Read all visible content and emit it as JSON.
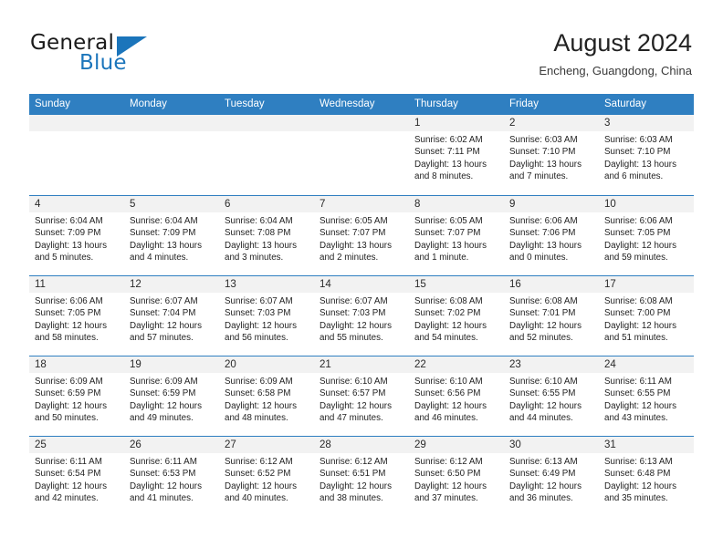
{
  "logo": {
    "word1": "General",
    "word2": "Blue",
    "triangle_color": "#1b75bb"
  },
  "header": {
    "title": "August 2024",
    "subtitle": "Encheng, Guangdong, China"
  },
  "theme": {
    "header_blue": "#2f7fc1",
    "date_band_gray": "#f2f2f2",
    "body_white": "#ffffff"
  },
  "weekdays": [
    "Sunday",
    "Monday",
    "Tuesday",
    "Wednesday",
    "Thursday",
    "Friday",
    "Saturday"
  ],
  "weeks": [
    [
      {
        "day": "",
        "sunrise": "",
        "sunset": "",
        "daylight_line1": "",
        "daylight_line2": ""
      },
      {
        "day": "",
        "sunrise": "",
        "sunset": "",
        "daylight_line1": "",
        "daylight_line2": ""
      },
      {
        "day": "",
        "sunrise": "",
        "sunset": "",
        "daylight_line1": "",
        "daylight_line2": ""
      },
      {
        "day": "",
        "sunrise": "",
        "sunset": "",
        "daylight_line1": "",
        "daylight_line2": ""
      },
      {
        "day": "1",
        "sunrise": "Sunrise: 6:02 AM",
        "sunset": "Sunset: 7:11 PM",
        "daylight_line1": "Daylight: 13 hours",
        "daylight_line2": "and 8 minutes."
      },
      {
        "day": "2",
        "sunrise": "Sunrise: 6:03 AM",
        "sunset": "Sunset: 7:10 PM",
        "daylight_line1": "Daylight: 13 hours",
        "daylight_line2": "and 7 minutes."
      },
      {
        "day": "3",
        "sunrise": "Sunrise: 6:03 AM",
        "sunset": "Sunset: 7:10 PM",
        "daylight_line1": "Daylight: 13 hours",
        "daylight_line2": "and 6 minutes."
      }
    ],
    [
      {
        "day": "4",
        "sunrise": "Sunrise: 6:04 AM",
        "sunset": "Sunset: 7:09 PM",
        "daylight_line1": "Daylight: 13 hours",
        "daylight_line2": "and 5 minutes."
      },
      {
        "day": "5",
        "sunrise": "Sunrise: 6:04 AM",
        "sunset": "Sunset: 7:09 PM",
        "daylight_line1": "Daylight: 13 hours",
        "daylight_line2": "and 4 minutes."
      },
      {
        "day": "6",
        "sunrise": "Sunrise: 6:04 AM",
        "sunset": "Sunset: 7:08 PM",
        "daylight_line1": "Daylight: 13 hours",
        "daylight_line2": "and 3 minutes."
      },
      {
        "day": "7",
        "sunrise": "Sunrise: 6:05 AM",
        "sunset": "Sunset: 7:07 PM",
        "daylight_line1": "Daylight: 13 hours",
        "daylight_line2": "and 2 minutes."
      },
      {
        "day": "8",
        "sunrise": "Sunrise: 6:05 AM",
        "sunset": "Sunset: 7:07 PM",
        "daylight_line1": "Daylight: 13 hours",
        "daylight_line2": "and 1 minute."
      },
      {
        "day": "9",
        "sunrise": "Sunrise: 6:06 AM",
        "sunset": "Sunset: 7:06 PM",
        "daylight_line1": "Daylight: 13 hours",
        "daylight_line2": "and 0 minutes."
      },
      {
        "day": "10",
        "sunrise": "Sunrise: 6:06 AM",
        "sunset": "Sunset: 7:05 PM",
        "daylight_line1": "Daylight: 12 hours",
        "daylight_line2": "and 59 minutes."
      }
    ],
    [
      {
        "day": "11",
        "sunrise": "Sunrise: 6:06 AM",
        "sunset": "Sunset: 7:05 PM",
        "daylight_line1": "Daylight: 12 hours",
        "daylight_line2": "and 58 minutes."
      },
      {
        "day": "12",
        "sunrise": "Sunrise: 6:07 AM",
        "sunset": "Sunset: 7:04 PM",
        "daylight_line1": "Daylight: 12 hours",
        "daylight_line2": "and 57 minutes."
      },
      {
        "day": "13",
        "sunrise": "Sunrise: 6:07 AM",
        "sunset": "Sunset: 7:03 PM",
        "daylight_line1": "Daylight: 12 hours",
        "daylight_line2": "and 56 minutes."
      },
      {
        "day": "14",
        "sunrise": "Sunrise: 6:07 AM",
        "sunset": "Sunset: 7:03 PM",
        "daylight_line1": "Daylight: 12 hours",
        "daylight_line2": "and 55 minutes."
      },
      {
        "day": "15",
        "sunrise": "Sunrise: 6:08 AM",
        "sunset": "Sunset: 7:02 PM",
        "daylight_line1": "Daylight: 12 hours",
        "daylight_line2": "and 54 minutes."
      },
      {
        "day": "16",
        "sunrise": "Sunrise: 6:08 AM",
        "sunset": "Sunset: 7:01 PM",
        "daylight_line1": "Daylight: 12 hours",
        "daylight_line2": "and 52 minutes."
      },
      {
        "day": "17",
        "sunrise": "Sunrise: 6:08 AM",
        "sunset": "Sunset: 7:00 PM",
        "daylight_line1": "Daylight: 12 hours",
        "daylight_line2": "and 51 minutes."
      }
    ],
    [
      {
        "day": "18",
        "sunrise": "Sunrise: 6:09 AM",
        "sunset": "Sunset: 6:59 PM",
        "daylight_line1": "Daylight: 12 hours",
        "daylight_line2": "and 50 minutes."
      },
      {
        "day": "19",
        "sunrise": "Sunrise: 6:09 AM",
        "sunset": "Sunset: 6:59 PM",
        "daylight_line1": "Daylight: 12 hours",
        "daylight_line2": "and 49 minutes."
      },
      {
        "day": "20",
        "sunrise": "Sunrise: 6:09 AM",
        "sunset": "Sunset: 6:58 PM",
        "daylight_line1": "Daylight: 12 hours",
        "daylight_line2": "and 48 minutes."
      },
      {
        "day": "21",
        "sunrise": "Sunrise: 6:10 AM",
        "sunset": "Sunset: 6:57 PM",
        "daylight_line1": "Daylight: 12 hours",
        "daylight_line2": "and 47 minutes."
      },
      {
        "day": "22",
        "sunrise": "Sunrise: 6:10 AM",
        "sunset": "Sunset: 6:56 PM",
        "daylight_line1": "Daylight: 12 hours",
        "daylight_line2": "and 46 minutes."
      },
      {
        "day": "23",
        "sunrise": "Sunrise: 6:10 AM",
        "sunset": "Sunset: 6:55 PM",
        "daylight_line1": "Daylight: 12 hours",
        "daylight_line2": "and 44 minutes."
      },
      {
        "day": "24",
        "sunrise": "Sunrise: 6:11 AM",
        "sunset": "Sunset: 6:55 PM",
        "daylight_line1": "Daylight: 12 hours",
        "daylight_line2": "and 43 minutes."
      }
    ],
    [
      {
        "day": "25",
        "sunrise": "Sunrise: 6:11 AM",
        "sunset": "Sunset: 6:54 PM",
        "daylight_line1": "Daylight: 12 hours",
        "daylight_line2": "and 42 minutes."
      },
      {
        "day": "26",
        "sunrise": "Sunrise: 6:11 AM",
        "sunset": "Sunset: 6:53 PM",
        "daylight_line1": "Daylight: 12 hours",
        "daylight_line2": "and 41 minutes."
      },
      {
        "day": "27",
        "sunrise": "Sunrise: 6:12 AM",
        "sunset": "Sunset: 6:52 PM",
        "daylight_line1": "Daylight: 12 hours",
        "daylight_line2": "and 40 minutes."
      },
      {
        "day": "28",
        "sunrise": "Sunrise: 6:12 AM",
        "sunset": "Sunset: 6:51 PM",
        "daylight_line1": "Daylight: 12 hours",
        "daylight_line2": "and 38 minutes."
      },
      {
        "day": "29",
        "sunrise": "Sunrise: 6:12 AM",
        "sunset": "Sunset: 6:50 PM",
        "daylight_line1": "Daylight: 12 hours",
        "daylight_line2": "and 37 minutes."
      },
      {
        "day": "30",
        "sunrise": "Sunrise: 6:13 AM",
        "sunset": "Sunset: 6:49 PM",
        "daylight_line1": "Daylight: 12 hours",
        "daylight_line2": "and 36 minutes."
      },
      {
        "day": "31",
        "sunrise": "Sunrise: 6:13 AM",
        "sunset": "Sunset: 6:48 PM",
        "daylight_line1": "Daylight: 12 hours",
        "daylight_line2": "and 35 minutes."
      }
    ]
  ]
}
